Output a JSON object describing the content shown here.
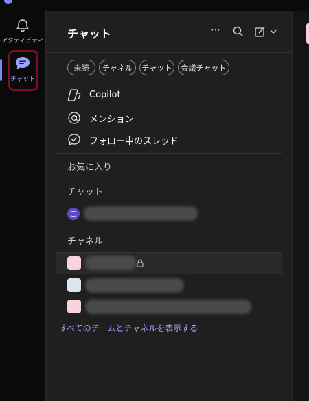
{
  "rail": {
    "activity_label": "アクティビティ",
    "chat_label": "チャット",
    "accent": "#7f85f5"
  },
  "header": {
    "title": "チャット"
  },
  "filters": [
    "未読",
    "チャネル",
    "チャット",
    "会議チャット"
  ],
  "nav": [
    {
      "label": "Copilot",
      "icon": "copilot-icon"
    },
    {
      "label": "メンション",
      "icon": "at-mention-icon"
    },
    {
      "label": "フォロー中のスレッド",
      "icon": "followed-threads-icon"
    }
  ],
  "sections": {
    "favorites": "お気に入り",
    "chats": "チャット",
    "channels": "チャネル"
  },
  "channel_colors": [
    "#f8d3dc",
    "#dbe6ee",
    "#f8d3dc"
  ],
  "footer_link": "すべてのチームとチャネルを表示する"
}
